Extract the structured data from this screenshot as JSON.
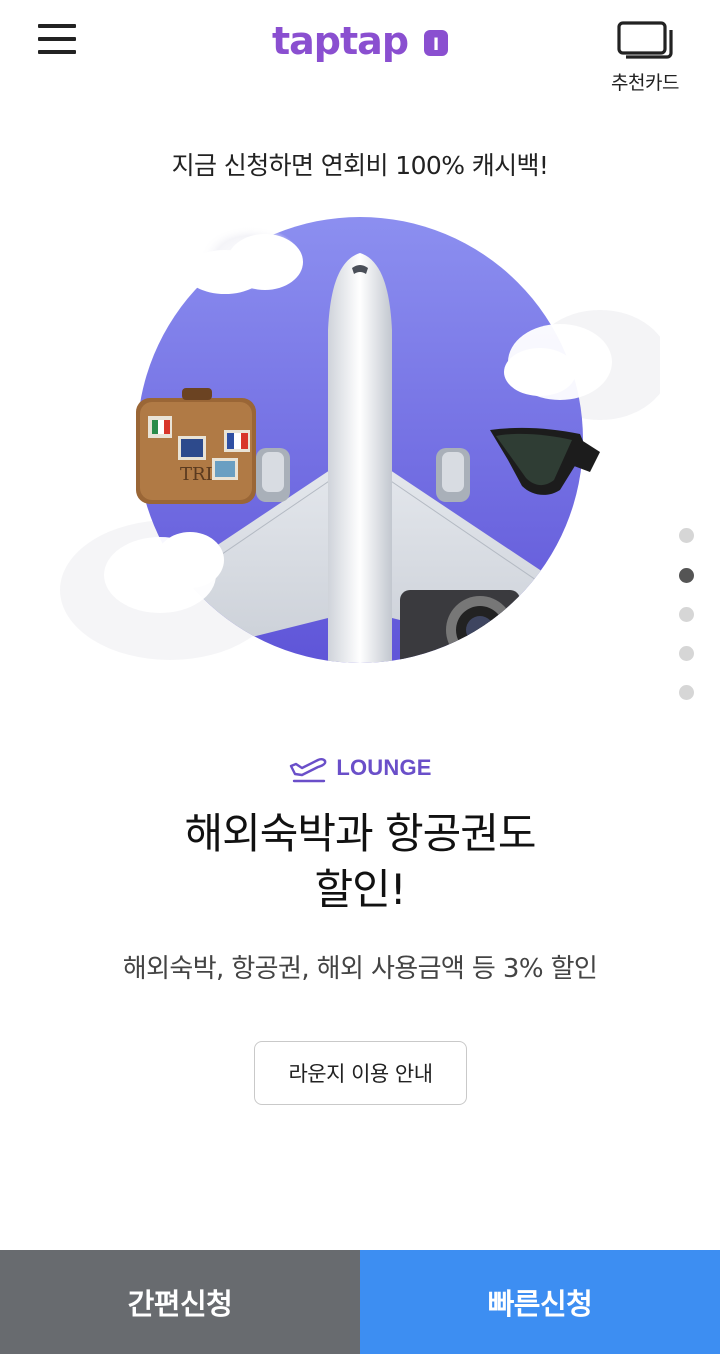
{
  "header": {
    "menu_icon": "hamburger-menu-icon",
    "logo_text": "taptap",
    "logo_badge": "I",
    "brand_color": "#8a4fd0",
    "recommend_label": "추천카드",
    "recommend_icon": "cards-stack-icon"
  },
  "promo": {
    "text": "지금 신청하면 연회비 100% 캐시백!"
  },
  "carousel": {
    "slide_count": 5,
    "active_index": 1
  },
  "slide": {
    "category_icon": "airplane-takeoff-icon",
    "category_label": "LOUNGE",
    "category_color": "#6a4fc9",
    "title_line1": "해외숙박과 항공권도",
    "title_line2": "할인!",
    "description": "해외숙박, 항공권, 해외 사용금액 등 3% 할인",
    "guide_button": "라운지 이용 안내"
  },
  "bottom_bar": {
    "simple_apply": "간편신청",
    "fast_apply": "빠른신청",
    "simple_color": "#686b6f",
    "fast_color": "#3d8ef2"
  }
}
